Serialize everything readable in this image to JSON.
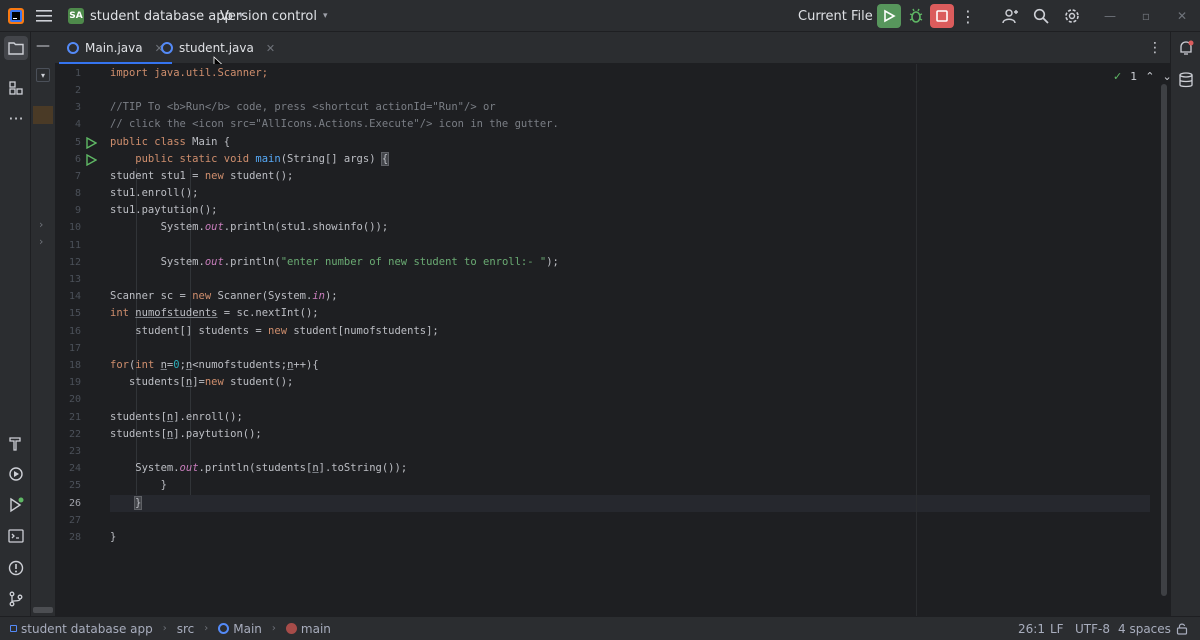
{
  "titlebar": {
    "project_badge": "SA",
    "project_name": "student database app",
    "vcs_label": "Version control",
    "run_config": "Current File",
    "icons": [
      "app-logo-icon",
      "main-menu-icon",
      "run-icon",
      "debug-icon",
      "stop-icon",
      "more-icon",
      "add-user-icon",
      "search-icon",
      "settings-icon",
      "minimize-icon",
      "restore-icon",
      "close-icon"
    ]
  },
  "tabs": [
    {
      "label": "Main.java",
      "active": true
    },
    {
      "label": "student.java",
      "active": false
    }
  ],
  "editor": {
    "inspection_count": "1",
    "current_line": 26,
    "lines": [
      {
        "n": "1"
      },
      {
        "n": "2"
      },
      {
        "n": "3"
      },
      {
        "n": "4"
      },
      {
        "n": "5"
      },
      {
        "n": "6"
      },
      {
        "n": "7"
      },
      {
        "n": "8"
      },
      {
        "n": "9"
      },
      {
        "n": "10"
      },
      {
        "n": "11"
      },
      {
        "n": "12"
      },
      {
        "n": "13"
      },
      {
        "n": "14"
      },
      {
        "n": "15"
      },
      {
        "n": "16"
      },
      {
        "n": "17"
      },
      {
        "n": "18"
      },
      {
        "n": "19"
      },
      {
        "n": "20"
      },
      {
        "n": "21"
      },
      {
        "n": "22"
      },
      {
        "n": "23"
      },
      {
        "n": "24"
      },
      {
        "n": "25"
      },
      {
        "n": "26"
      },
      {
        "n": "27"
      },
      {
        "n": "28"
      }
    ],
    "code": {
      "l1": "import java.util.Scanner;",
      "l3": "//TIP To <b>Run</b> code, press <shortcut actionId=\"Run\"/> or",
      "l4": "// click the <icon src=\"AllIcons.Actions.Execute\"/> icon in the gutter.",
      "l5a": "public class",
      "l5b": " Main {",
      "l6a": "    public static void ",
      "l6b": "main",
      "l6c": "(String[] args) ",
      "l6d": "{",
      "l7a": "student stu1 = ",
      "l7b": "new",
      "l7c": " student();",
      "l8": "stu1.enroll();",
      "l9": "stu1.paytution();",
      "l10a": "        System.",
      "l10b": "out",
      "l10c": ".println(stu1.showinfo());",
      "l12a": "        System.",
      "l12b": "out",
      "l12c": ".println(",
      "l12d": "\"enter number of new student to enroll:- \"",
      "l12e": ");",
      "l14a": "Scanner sc = ",
      "l14b": "new",
      "l14c": " Scanner(System.",
      "l14d": "in",
      "l14e": ");",
      "l15a": "int",
      "l15b": " ",
      "l15c": "numofstudents",
      "l15d": " = sc.nextInt();",
      "l16a": "    student[] students = ",
      "l16b": "new",
      "l16c": " student[numofstudents];",
      "l18a": "for",
      "l18b": "(",
      "l18c": "int",
      "l18d": " ",
      "l18e": "n",
      "l18f": "=",
      "l18g": "0",
      "l18h": ";",
      "l18i": "n",
      "l18j": "<numofstudents;",
      "l18k": "n",
      "l18l": "++){",
      "l19a": "   students[",
      "l19b": "n",
      "l19c": "]=",
      "l19d": "new",
      "l19e": " student();",
      "l21a": "students[",
      "l21b": "n",
      "l21c": "].enroll();",
      "l22a": "students[",
      "l22b": "n",
      "l22c": "].paytution();",
      "l24a": "    System.",
      "l24b": "out",
      "l24c": ".println(students[",
      "l24d": "n",
      "l24e": "].toString());",
      "l25": "        }",
      "l26": "}",
      "l28": "}"
    }
  },
  "statusbar": {
    "breadcrumb": [
      "student database app",
      "src",
      "Main",
      "main"
    ],
    "position": "26:1",
    "line_sep": "LF",
    "encoding": "UTF-8",
    "indent": "4 spaces"
  },
  "colors": {
    "accent": "#3574f0",
    "run_green": "#57965c",
    "stop_red": "#db5c5c"
  }
}
